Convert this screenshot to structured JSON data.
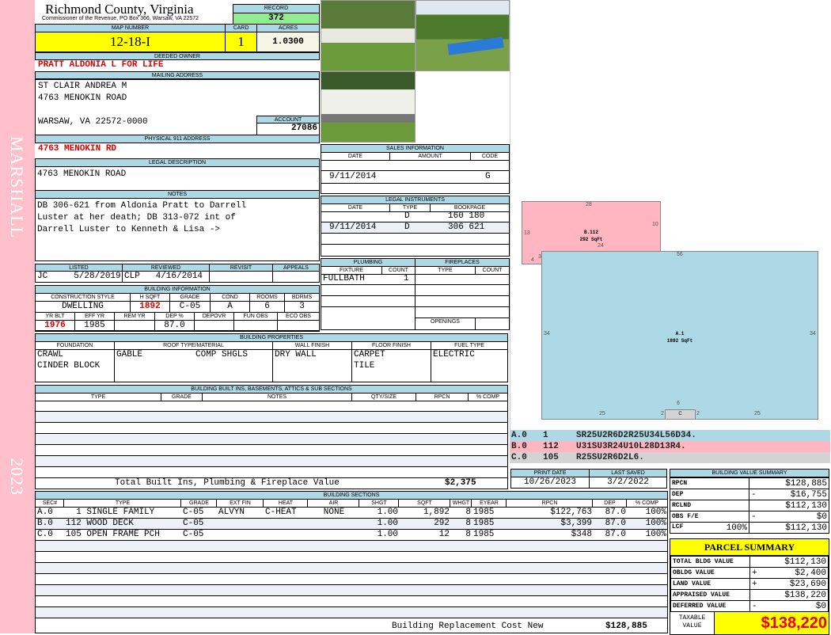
{
  "side": {
    "district": "MARSHALL",
    "year": "2023"
  },
  "header": {
    "county": "Richmond County, Virginia",
    "subtitle": "Commissioner of the Revenue, PO Box 366, Warsaw, VA 22572",
    "record_label": "RECORD",
    "record": "372"
  },
  "parcel": {
    "map_label": "MAP NUMBER",
    "map": "12-18-I",
    "card_label": "CARD",
    "card": "1",
    "acres_label": "ACRES",
    "acres": "1.0300"
  },
  "owner": {
    "label": "DEEDED OWNER",
    "name": "PRATT ALDONIA L FOR LIFE"
  },
  "mailing": {
    "label": "MAILING ADDRESS",
    "lines": [
      "ST CLAIR ANDREA M",
      "4763 MENOKIN ROAD",
      "",
      "WARSAW, VA 22572-0000"
    ],
    "account_label": "ACCOUNT",
    "account": "27086"
  },
  "physical": {
    "label": "PHYSICAL 911 ADDRESS",
    "value": "4763 MENOKIN RD"
  },
  "legal": {
    "label": "LEGAL DESCRIPTION",
    "value": "4763 MENOKIN ROAD"
  },
  "notes": {
    "label": "NOTES",
    "lines": [
      "DB 306-621 from Aldonia Pratt to Darrell",
      "Luster at her death; DB 313-072 int of",
      "Darrell Luster to Kenneth & Lisa  ->"
    ]
  },
  "review": {
    "listed_label": "LISTED",
    "listed": "JC     5/28/2019",
    "reviewed_label": "REVIEWED",
    "reviewed": "CLP   4/16/2014",
    "revisit_label": "REVISIT",
    "appeals_label": "APPEALS"
  },
  "building_info": {
    "label": "BUILDING INFORMATION",
    "style_label": "CONSTRUCTION STYLE",
    "style": "DWELLING",
    "hsqft_label": "H SQFT",
    "hsqft": "1892",
    "grade_label": "GRADE",
    "grade": "C-05",
    "cond_label": "COND",
    "cond": "A",
    "rooms_label": "ROOMS",
    "rooms": "6",
    "bdrms_label": "BDRMS",
    "bdrms": "3",
    "yrblt_label": "YR BLT",
    "yrblt": "1976",
    "effyr_label": "EFF YR",
    "effyr": "1985",
    "remyr_label": "REM YR",
    "dep_label": "DEP %",
    "dep": "87.0",
    "depovr_label": "DEPOVR",
    "funobs_label": "FUN OBS",
    "ecoobs_label": "ECO OBS"
  },
  "properties": {
    "label": "BUILDING PROPERTIES",
    "cols": [
      "FOUNDATION",
      "ROOF TYPE/MATERIAL",
      "WALL FINISH",
      "FLOOR FINISH",
      "FUEL TYPE"
    ],
    "foundation": [
      "CRAWL",
      "CINDER BLOCK"
    ],
    "roof_type": "GABLE",
    "roof_material": "COMP SHGLS",
    "wall": "DRY WALL",
    "floor": [
      "CARPET",
      "TILE"
    ],
    "fuel": "ELECTRIC"
  },
  "builtins": {
    "label": "BUILDING BUILT INS, BASEMENTS, ATTICS & SUB SECTIONS",
    "cols": [
      "TYPE",
      "GRADE",
      "NOTES",
      "QTY/SIZE",
      "RPCN",
      "% COMP"
    ],
    "total_label": "Total Built Ins, Plumbing & Fireplace Value",
    "total": "$2,375"
  },
  "sales": {
    "label": "SALES INFORMATION",
    "cols": [
      "DATE",
      "AMOUNT",
      "CODE"
    ],
    "rows": [
      {
        "date": "",
        "amount": "",
        "code": ""
      },
      {
        "date": "9/11/2014",
        "amount": "",
        "code": "G"
      }
    ]
  },
  "instruments": {
    "label": "LEGAL INSTRUMENTS",
    "cols": [
      "DATE",
      "TYPE",
      "BOOKPAGE"
    ],
    "rows": [
      {
        "date": "",
        "type": "D",
        "bookpage": "160 180"
      },
      {
        "date": "9/11/2014",
        "type": "D",
        "bookpage": "306 621"
      }
    ]
  },
  "plumbing": {
    "label": "PLUMBING",
    "cols": [
      "FIXTURE",
      "COUNT"
    ],
    "fixture": "FULLBATH",
    "count": "1"
  },
  "fireplaces": {
    "label": "FIREPLACES",
    "cols": [
      "TYPE",
      "COUNT"
    ],
    "openings_label": "OPENINGS"
  },
  "sketch": {
    "b_label": "B.112",
    "b_area": "292 SqFt",
    "a_label": "A.1",
    "a_area": "1892 SqFt",
    "c_label": "C",
    "dims": {
      "b_top": "28",
      "b_right": "10",
      "b_left": "13",
      "b_bottom": "24",
      "b_3": "3",
      "b_4": "4",
      "a_top": "56",
      "a_left": "34",
      "a_right": "34",
      "a_bl": "25",
      "a_br": "25",
      "c_top": "6",
      "c_l": "2",
      "c_r": "2"
    },
    "codes": [
      {
        "sec": "A.0",
        "code": "1",
        "path": "SR25U2R6D2R25U34L56D34.",
        "color": "#add8e6"
      },
      {
        "sec": "B.0",
        "code": "112",
        "path": "U31SU3R24U10L28D13R4.",
        "color": "#ffb6c1"
      },
      {
        "sec": "C.0",
        "code": "105",
        "path": "R25SU2R6D2L6.",
        "color": "#d3d3d3"
      }
    ]
  },
  "dates": {
    "print_label": "PRINT DATE",
    "print": "10/26/2023",
    "saved_label": "LAST SAVED",
    "saved": "3/2/2022"
  },
  "value_summary": {
    "label": "BUILDING VALUE SUMMARY",
    "rows": [
      {
        "label": "RPCN",
        "sign": "",
        "value": "$128,885"
      },
      {
        "label": "DEP",
        "sign": "-",
        "value": "$16,755"
      },
      {
        "label": "RCLND",
        "sign": "",
        "value": "$112,130"
      },
      {
        "label": "OBS F/E",
        "sign": "-",
        "value": "$0"
      },
      {
        "label": "LCF",
        "pct": "100%",
        "sign": "",
        "value": "$112,130"
      }
    ]
  },
  "parcel_summary": {
    "label": "PARCEL SUMMARY",
    "rows": [
      {
        "label": "TOTAL BLDG VALUE",
        "sign": "",
        "value": "$112,130"
      },
      {
        "label": "OBLDG VALUE",
        "sign": "+",
        "value": "$2,400"
      },
      {
        "label": "LAND VALUE",
        "sign": "+",
        "value": "$23,690"
      },
      {
        "label": "APPRAISED VALUE",
        "sign": "",
        "value": "$138,220"
      },
      {
        "label": "DEFERRED VALUE",
        "sign": "-",
        "value": "$0"
      }
    ],
    "taxable_label": "TAXABLE VALUE",
    "taxable": "$138,220"
  },
  "sections": {
    "label": "BUILDING SECTIONS",
    "cols": [
      "SEC#",
      "TYPE",
      "GRADE",
      "EXT FIN",
      "HEAT",
      "AIR",
      "SHGT",
      "SQFT",
      "WHGT",
      "EYEAR",
      "RPCN",
      "DEP",
      "% COMP"
    ],
    "rows": [
      [
        "A.0",
        "  1 SINGLE FAMILY",
        "C-05",
        "ALVYN",
        "C-HEAT",
        "NONE",
        "1.00",
        "1,892",
        "8",
        "1985",
        "$122,763",
        "87.0",
        "100%"
      ],
      [
        "B.0",
        "112 WOOD DECK",
        "C-05",
        "",
        "",
        "",
        "1.00",
        "292",
        "8",
        "1985",
        "$3,399",
        "87.0",
        "100%"
      ],
      [
        "C.0",
        "105 OPEN FRAME PCH",
        "C-05",
        "",
        "",
        "",
        "1.00",
        "12",
        "8",
        "1985",
        "$348",
        "87.0",
        "100%"
      ]
    ],
    "total_label": "Building Replacement Cost New",
    "total": "$128,885"
  }
}
